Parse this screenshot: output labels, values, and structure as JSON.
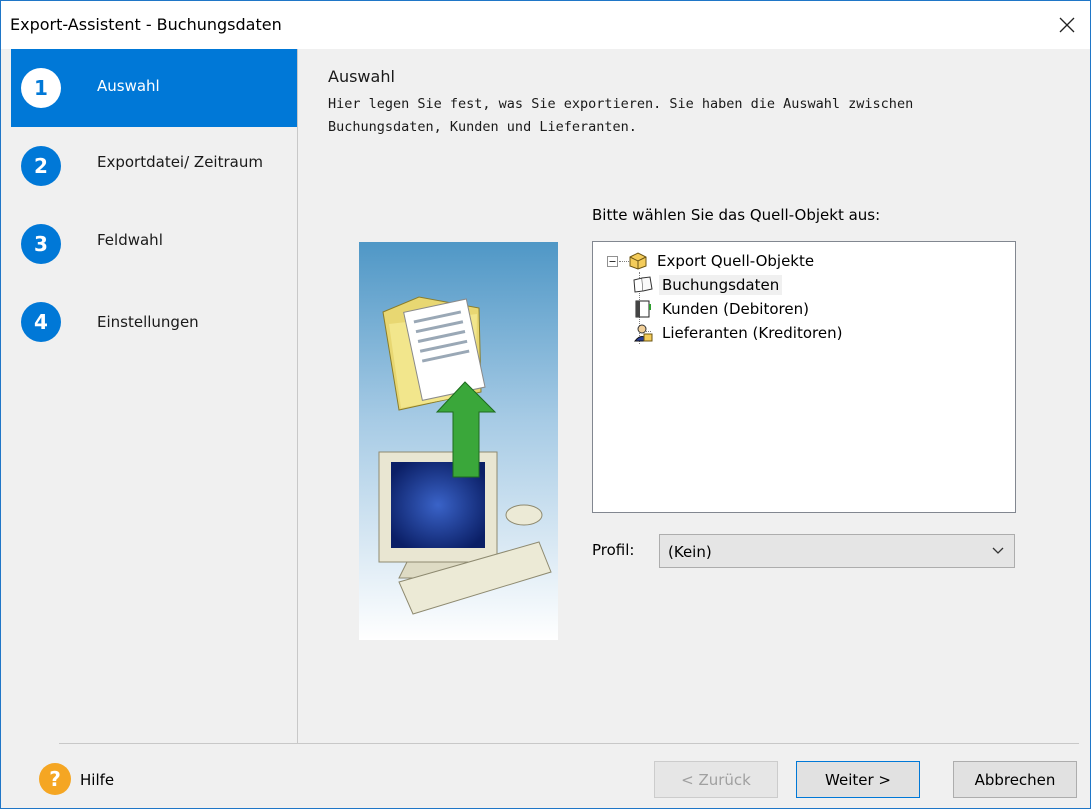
{
  "window": {
    "title": "Export-Assistent - Buchungsdaten"
  },
  "steps": [
    {
      "num": "1",
      "label": "Auswahl"
    },
    {
      "num": "2",
      "label": "Exportdatei/ Zeitraum"
    },
    {
      "num": "3",
      "label": "Feldwahl"
    },
    {
      "num": "4",
      "label": "Einstellungen"
    }
  ],
  "header": {
    "title": "Auswahl",
    "line1": "Hier legen Sie fest, was Sie exportieren. Sie haben die Auswahl zwischen",
    "line2": "Buchungsdaten, Kunden und Lieferanten."
  },
  "tree": {
    "prompt": "Bitte wählen Sie das Quell-Objekt aus:",
    "root": "Export Quell-Objekte",
    "items": [
      {
        "label": "Buchungsdaten",
        "icon": "book-icon"
      },
      {
        "label": "Kunden (Debitoren)",
        "icon": "ledger-icon"
      },
      {
        "label": "Lieferanten (Kreditoren)",
        "icon": "supplier-icon"
      }
    ]
  },
  "profile": {
    "label": "Profil:",
    "value": "(Kein)"
  },
  "footer": {
    "help": "Hilfe",
    "help_icon": "?",
    "back": "< Zurück",
    "next": "Weiter >",
    "cancel": "Abbrechen"
  },
  "colors": {
    "accent": "#0078d7",
    "help": "#f5a623"
  }
}
